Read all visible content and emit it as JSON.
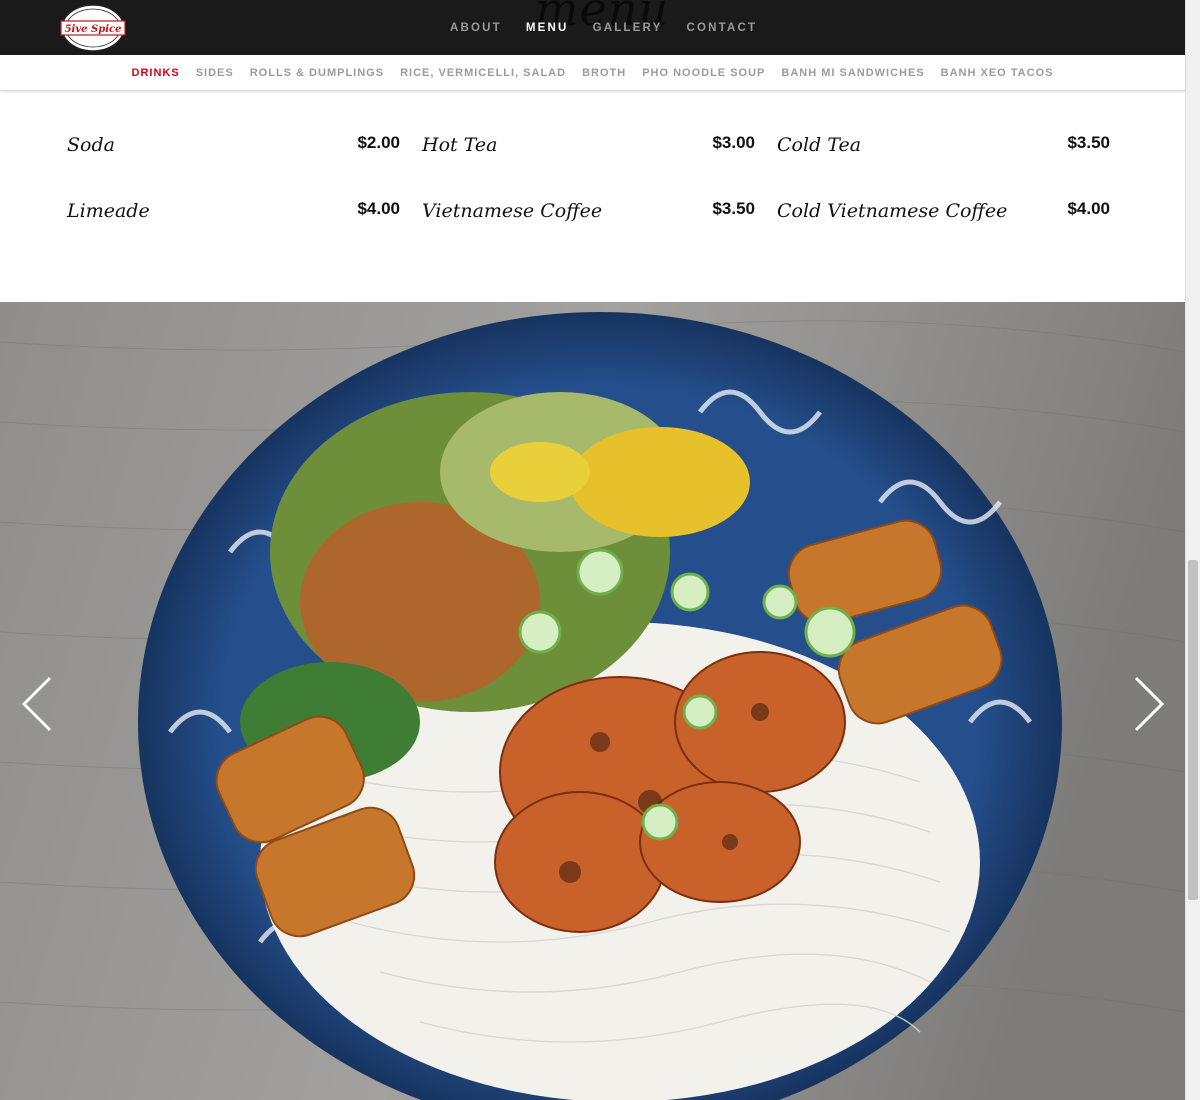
{
  "nav": {
    "logo_text": "5ive Spice",
    "ghost_title": "menu",
    "items": [
      {
        "label": "ABOUT",
        "active": false
      },
      {
        "label": "MENU",
        "active": true
      },
      {
        "label": "GALLERY",
        "active": false
      },
      {
        "label": "CONTACT",
        "active": false
      }
    ]
  },
  "subnav": {
    "items": [
      {
        "label": "DRINKS",
        "active": true
      },
      {
        "label": "SIDES",
        "active": false
      },
      {
        "label": "ROLLS & DUMPLINGS",
        "active": false
      },
      {
        "label": "RICE, VERMICELLI, SALAD",
        "active": false
      },
      {
        "label": "BROTH",
        "active": false
      },
      {
        "label": "PHO NOODLE SOUP",
        "active": false
      },
      {
        "label": "BANH MI SANDWICHES",
        "active": false
      },
      {
        "label": "BANH XEO TACOS",
        "active": false
      }
    ]
  },
  "menu": {
    "items": [
      {
        "name": "Soda",
        "price": "$2.00"
      },
      {
        "name": "Hot Tea",
        "price": "$3.00"
      },
      {
        "name": "Cold Tea",
        "price": "$3.50"
      },
      {
        "name": "Limeade",
        "price": "$4.00"
      },
      {
        "name": "Vietnamese Coffee",
        "price": "$3.50"
      },
      {
        "name": "Cold Vietnamese Coffee",
        "price": "$4.00"
      }
    ]
  },
  "slider": {
    "prev_icon": "chevron-left-icon",
    "next_icon": "chevron-right-icon"
  },
  "colors": {
    "nav_bg": "#1a1a1a",
    "accent": "#d0021b",
    "nav_inactive": "#9a9a9a"
  }
}
